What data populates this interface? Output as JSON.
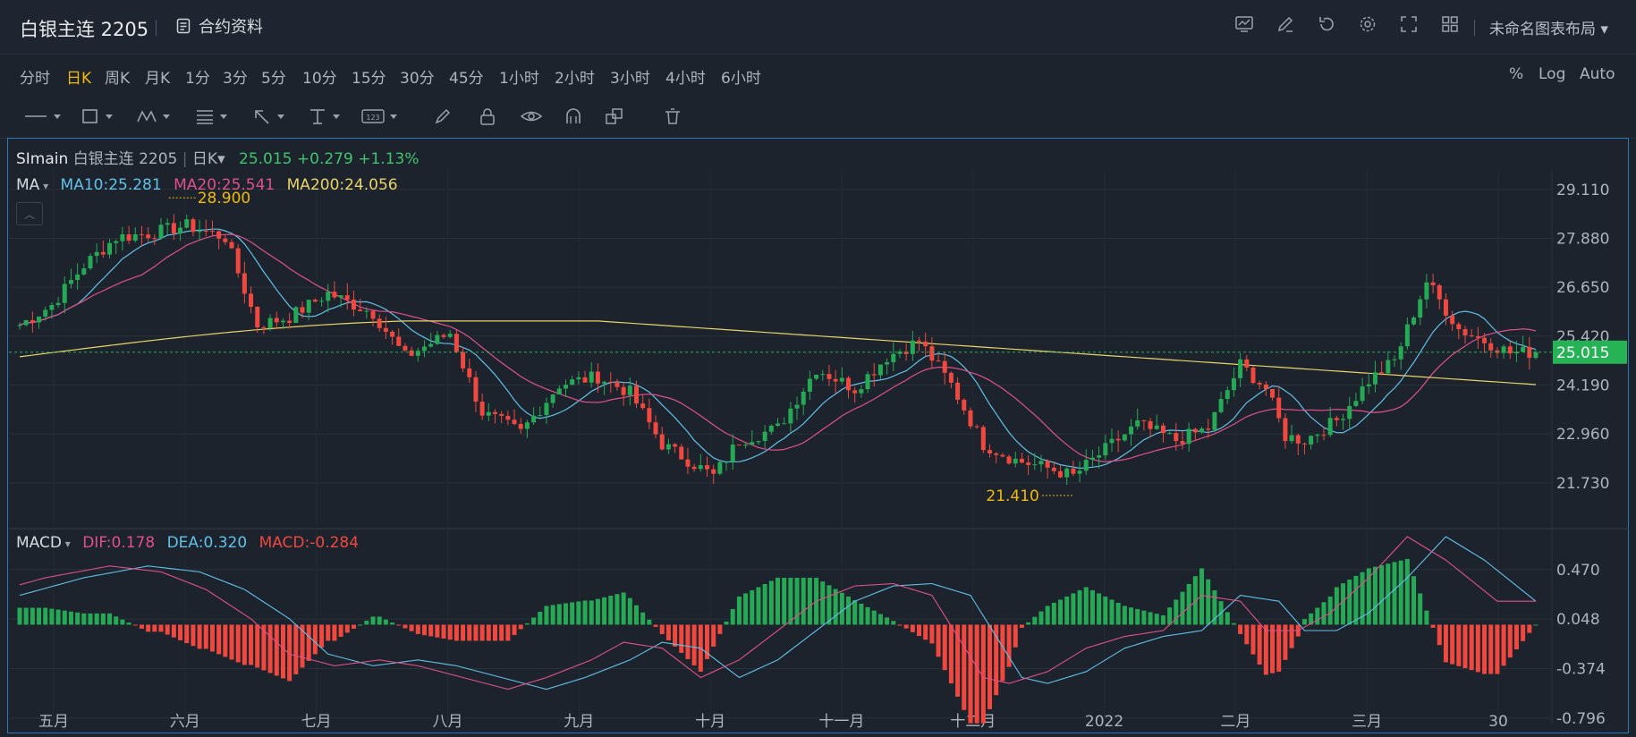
{
  "header": {
    "title": "白银主连 2205",
    "contract_label": "合约资料",
    "layout_label": "未命名图表布局"
  },
  "timeframes": [
    "分时",
    "日K",
    "周K",
    "月K",
    "1分",
    "3分",
    "5分",
    "10分",
    "15分",
    "30分",
    "45分",
    "1小时",
    "2小时",
    "3小时",
    "4小时",
    "6小时"
  ],
  "active_timeframe": "日K",
  "scale_options": [
    "%",
    "Log",
    "Auto"
  ],
  "legend": {
    "symbol": "SImain",
    "name": "白银主连 2205",
    "period": "日K",
    "price": "25.015",
    "change": "+0.279",
    "change_pct": "+1.13%",
    "ma_label": "MA",
    "ma10": "MA10:25.281",
    "ma20": "MA20:25.541",
    "ma200": "MA200:24.056",
    "macd_label": "MACD",
    "dif": "DIF:0.178",
    "dea": "DEA:0.320",
    "macd": "MACD:-0.284"
  },
  "colors": {
    "up": "#26a955",
    "down": "#f0483e",
    "ma10": "#62c0e8",
    "ma20": "#e0508a",
    "ma200": "#e8d36a",
    "price_tag": "#26b356",
    "accent": "#f0b90b"
  },
  "chart_data": {
    "type": "candlestick",
    "price_axis": {
      "ticks": [
        "29.110",
        "27.880",
        "26.650",
        "25.420",
        "24.190",
        "22.960",
        "21.730"
      ],
      "ylim": [
        20.6,
        29.6
      ]
    },
    "macd_axis": {
      "ticks": [
        "0.470",
        "0.048",
        "-0.374",
        "-0.796"
      ],
      "ylim": [
        -0.85,
        0.75
      ]
    },
    "x_labels": [
      "五月",
      "六月",
      "七月",
      "八月",
      "九月",
      "十月",
      "十一月",
      "十二月",
      "2022",
      "二月",
      "三月",
      "30"
    ],
    "last_price": "25.015",
    "annotations": {
      "high": "28.900",
      "low": "21.410"
    },
    "price_path": [
      [
        0,
        25.7
      ],
      [
        5,
        26.2
      ],
      [
        10,
        27.2
      ],
      [
        15,
        27.9
      ],
      [
        20,
        28.0
      ],
      [
        26,
        28.2
      ],
      [
        32,
        27.9
      ],
      [
        37,
        25.7
      ],
      [
        42,
        25.9
      ],
      [
        48,
        26.5
      ],
      [
        55,
        26.0
      ],
      [
        60,
        24.9
      ],
      [
        67,
        25.5
      ],
      [
        72,
        23.5
      ],
      [
        78,
        23.0
      ],
      [
        84,
        24.2
      ],
      [
        90,
        24.4
      ],
      [
        95,
        24.0
      ],
      [
        100,
        22.7
      ],
      [
        105,
        22.2
      ],
      [
        108,
        21.9
      ],
      [
        112,
        22.8
      ],
      [
        118,
        23.1
      ],
      [
        124,
        24.6
      ],
      [
        130,
        24.1
      ],
      [
        135,
        24.9
      ],
      [
        140,
        25.3
      ],
      [
        145,
        24.2
      ],
      [
        150,
        22.7
      ],
      [
        155,
        22.3
      ],
      [
        160,
        22.1
      ],
      [
        164,
        21.9
      ],
      [
        170,
        22.7
      ],
      [
        174,
        23.2
      ],
      [
        180,
        22.8
      ],
      [
        185,
        23.1
      ],
      [
        190,
        24.7
      ],
      [
        194,
        24.1
      ],
      [
        197,
        22.9
      ],
      [
        200,
        22.8
      ],
      [
        205,
        23.3
      ],
      [
        210,
        24.3
      ],
      [
        214,
        24.8
      ],
      [
        219,
        26.8
      ],
      [
        224,
        25.6
      ],
      [
        228,
        25.3
      ],
      [
        232,
        25.0
      ],
      [
        236,
        25.015
      ]
    ],
    "macd_path": [
      [
        0,
        0.25
      ],
      [
        10,
        0.4
      ],
      [
        20,
        0.5
      ],
      [
        28,
        0.45
      ],
      [
        35,
        0.3
      ],
      [
        42,
        0.05
      ],
      [
        48,
        -0.25
      ],
      [
        55,
        -0.35
      ],
      [
        62,
        -0.3
      ],
      [
        68,
        -0.35
      ],
      [
        75,
        -0.45
      ],
      [
        82,
        -0.55
      ],
      [
        88,
        -0.45
      ],
      [
        95,
        -0.3
      ],
      [
        100,
        -0.15
      ],
      [
        106,
        -0.2
      ],
      [
        112,
        -0.45
      ],
      [
        118,
        -0.3
      ],
      [
        124,
        -0.05
      ],
      [
        130,
        0.2
      ],
      [
        136,
        0.33
      ],
      [
        142,
        0.35
      ],
      [
        148,
        0.25
      ],
      [
        152,
        -0.1
      ],
      [
        156,
        -0.45
      ],
      [
        160,
        -0.5
      ],
      [
        166,
        -0.4
      ],
      [
        172,
        -0.2
      ],
      [
        178,
        -0.1
      ],
      [
        184,
        -0.05
      ],
      [
        190,
        0.25
      ],
      [
        196,
        0.2
      ],
      [
        200,
        -0.05
      ],
      [
        205,
        -0.05
      ],
      [
        210,
        0.1
      ],
      [
        216,
        0.4
      ],
      [
        222,
        0.75
      ],
      [
        228,
        0.55
      ],
      [
        236,
        0.2
      ]
    ]
  }
}
